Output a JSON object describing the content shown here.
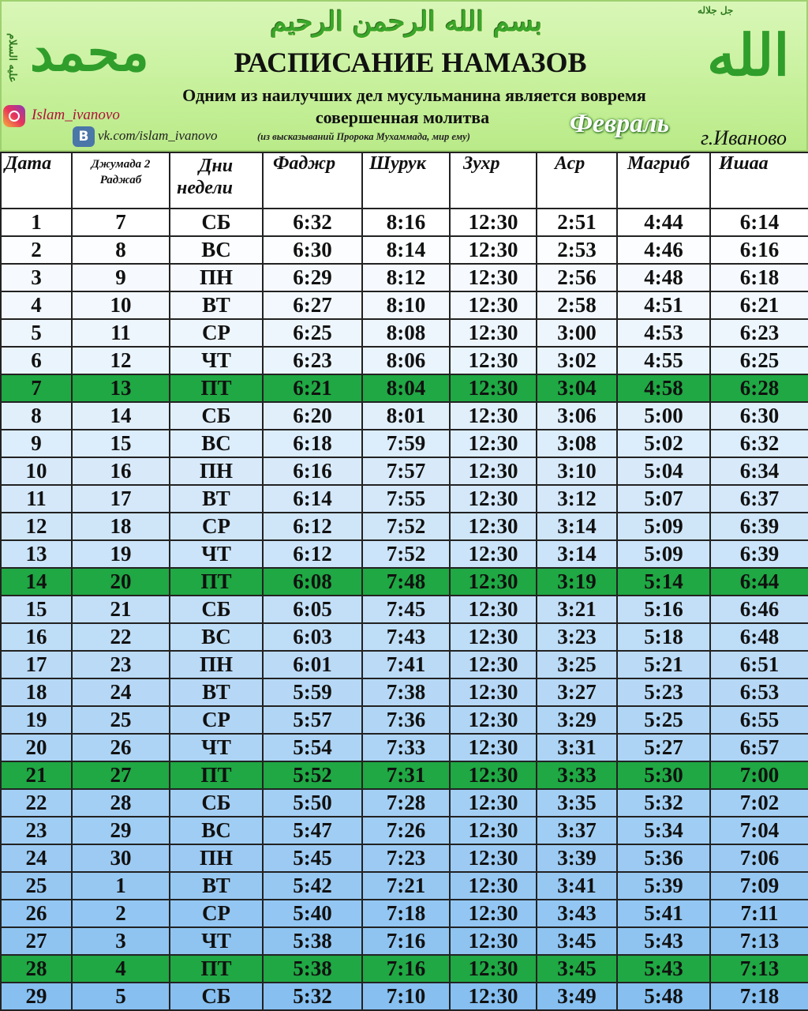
{
  "header": {
    "basmala": "بسم الله الرحمن الرحيم",
    "calligraphy_left": "محمد",
    "calligraphy_left_small": "عليه السلام",
    "calligraphy_right": "الله",
    "calligraphy_right_small": "جل جلاله",
    "title": "РАСПИСАНИЕ НАМАЗОВ",
    "subtitle_line1": "Одним из наилучших дел мусульманина является вовремя",
    "subtitle_line2": "совершенная молитва",
    "month": "Февраль",
    "city": "г.Иваново",
    "instagram": "Islam_ivanovo",
    "vk": "vk.com/islam_ivanovo",
    "vk_note": "(из высказываний Пророка Мухаммада, мир ему)",
    "vk_icon_letter": "B"
  },
  "columns": {
    "date": "Дата",
    "hijri_1": "Джумада 2",
    "hijri_2": "Раджаб",
    "day_1": "Дни",
    "day_2": "недели",
    "fajr": "Фаджр",
    "shuruk": "Шурук",
    "zuhr": "Зухр",
    "asr": "Аср",
    "maghrib": "Магриб",
    "isha": "Ишаа"
  },
  "rows": [
    [
      "1",
      "7",
      "СБ",
      "6:32",
      "8:16",
      "12:30",
      "2:51",
      "4:44",
      "6:14"
    ],
    [
      "2",
      "8",
      "ВС",
      "6:30",
      "8:14",
      "12:30",
      "2:53",
      "4:46",
      "6:16"
    ],
    [
      "3",
      "9",
      "ПН",
      "6:29",
      "8:12",
      "12:30",
      "2:56",
      "4:48",
      "6:18"
    ],
    [
      "4",
      "10",
      "ВТ",
      "6:27",
      "8:10",
      "12:30",
      "2:58",
      "4:51",
      "6:21"
    ],
    [
      "5",
      "11",
      "СР",
      "6:25",
      "8:08",
      "12:30",
      "3:00",
      "4:53",
      "6:23"
    ],
    [
      "6",
      "12",
      "ЧТ",
      "6:23",
      "8:06",
      "12:30",
      "3:02",
      "4:55",
      "6:25"
    ],
    [
      "7",
      "13",
      "ПТ",
      "6:21",
      "8:04",
      "12:30",
      "3:04",
      "4:58",
      "6:28"
    ],
    [
      "8",
      "14",
      "СБ",
      "6:20",
      "8:01",
      "12:30",
      "3:06",
      "5:00",
      "6:30"
    ],
    [
      "9",
      "15",
      "ВС",
      "6:18",
      "7:59",
      "12:30",
      "3:08",
      "5:02",
      "6:32"
    ],
    [
      "10",
      "16",
      "ПН",
      "6:16",
      "7:57",
      "12:30",
      "3:10",
      "5:04",
      "6:34"
    ],
    [
      "11",
      "17",
      "ВТ",
      "6:14",
      "7:55",
      "12:30",
      "3:12",
      "5:07",
      "6:37"
    ],
    [
      "12",
      "18",
      "СР",
      "6:12",
      "7:52",
      "12:30",
      "3:14",
      "5:09",
      "6:39"
    ],
    [
      "13",
      "19",
      "ЧТ",
      "6:12",
      "7:52",
      "12:30",
      "3:14",
      "5:09",
      "6:39"
    ],
    [
      "14",
      "20",
      "ПТ",
      "6:08",
      "7:48",
      "12:30",
      "3:19",
      "5:14",
      "6:44"
    ],
    [
      "15",
      "21",
      "СБ",
      "6:05",
      "7:45",
      "12:30",
      "3:21",
      "5:16",
      "6:46"
    ],
    [
      "16",
      "22",
      "ВС",
      "6:03",
      "7:43",
      "12:30",
      "3:23",
      "5:18",
      "6:48"
    ],
    [
      "17",
      "23",
      "ПН",
      "6:01",
      "7:41",
      "12:30",
      "3:25",
      "5:21",
      "6:51"
    ],
    [
      "18",
      "24",
      "ВТ",
      "5:59",
      "7:38",
      "12:30",
      "3:27",
      "5:23",
      "6:53"
    ],
    [
      "19",
      "25",
      "СР",
      "5:57",
      "7:36",
      "12:30",
      "3:29",
      "5:25",
      "6:55"
    ],
    [
      "20",
      "26",
      "ЧТ",
      "5:54",
      "7:33",
      "12:30",
      "3:31",
      "5:27",
      "6:57"
    ],
    [
      "21",
      "27",
      "ПТ",
      "5:52",
      "7:31",
      "12:30",
      "3:33",
      "5:30",
      "7:00"
    ],
    [
      "22",
      "28",
      "СБ",
      "5:50",
      "7:28",
      "12:30",
      "3:35",
      "5:32",
      "7:02"
    ],
    [
      "23",
      "29",
      "ВС",
      "5:47",
      "7:26",
      "12:30",
      "3:37",
      "5:34",
      "7:04"
    ],
    [
      "24",
      "30",
      "ПН",
      "5:45",
      "7:23",
      "12:30",
      "3:39",
      "5:36",
      "7:06"
    ],
    [
      "25",
      "1",
      "ВТ",
      "5:42",
      "7:21",
      "12:30",
      "3:41",
      "5:39",
      "7:09"
    ],
    [
      "26",
      "2",
      "СР",
      "5:40",
      "7:18",
      "12:30",
      "3:43",
      "5:41",
      "7:11"
    ],
    [
      "27",
      "3",
      "ЧТ",
      "5:38",
      "7:16",
      "12:30",
      "3:45",
      "5:43",
      "7:13"
    ],
    [
      "28",
      "4",
      "ПТ",
      "5:38",
      "7:16",
      "12:30",
      "3:45",
      "5:43",
      "7:13"
    ],
    [
      "29",
      "5",
      "СБ",
      "5:32",
      "7:10",
      "12:30",
      "3:49",
      "5:48",
      "7:18"
    ]
  ],
  "friday_label": "ПТ",
  "colors": {
    "friday_row": "#1fa843",
    "row_gradient_top": "#ffffff",
    "row_gradient_bottom": "#86bff0",
    "header_green": "#c6f09a",
    "calligraphy_green": "#2f9e2a"
  }
}
